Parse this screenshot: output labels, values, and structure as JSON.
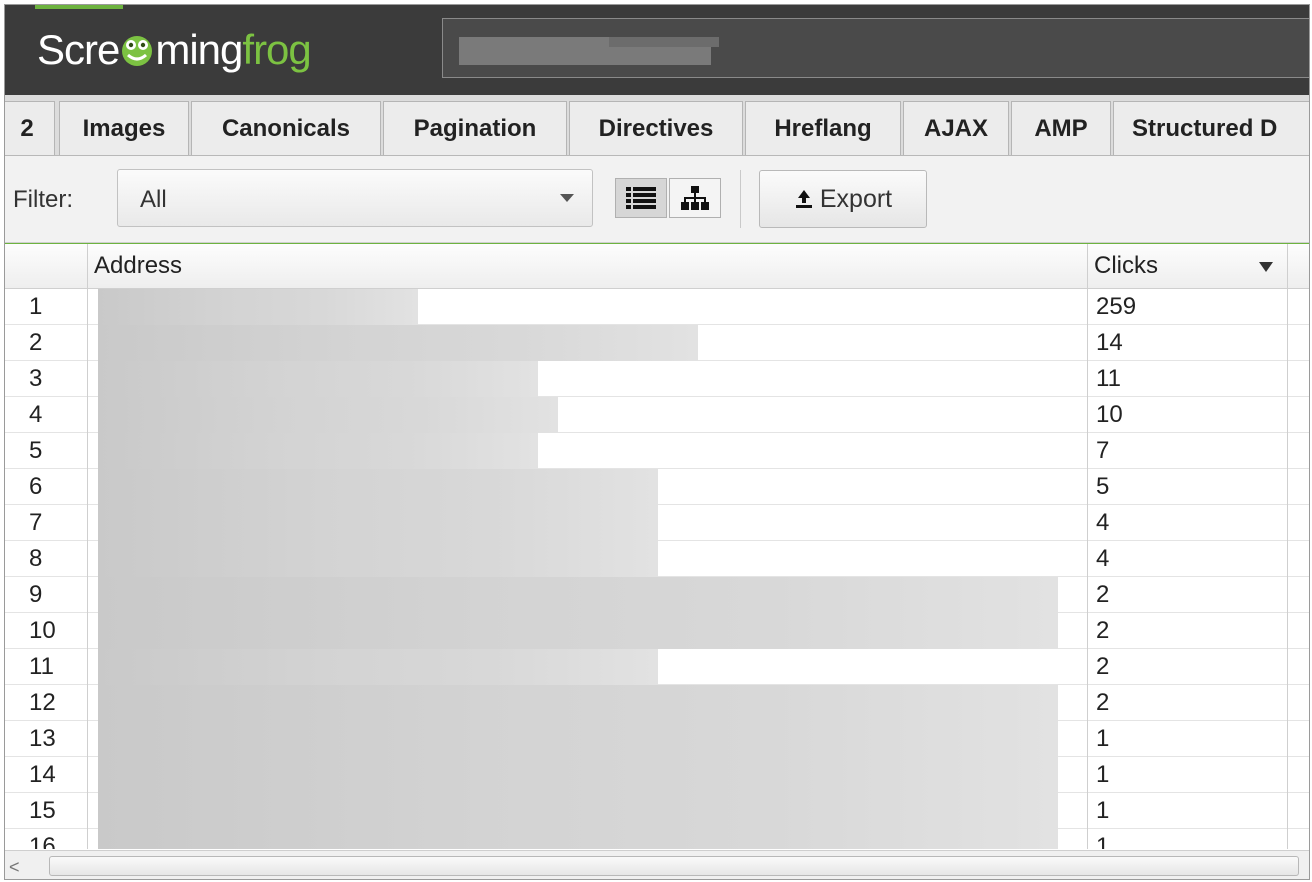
{
  "app": {
    "logo_part1": "Scre",
    "logo_part2": "ming",
    "logo_part3": "frog",
    "accent_color": "#7cc242"
  },
  "url_bar": {
    "value": ""
  },
  "tabs": [
    {
      "label": "2"
    },
    {
      "label": "Images"
    },
    {
      "label": "Canonicals"
    },
    {
      "label": "Pagination"
    },
    {
      "label": "Directives"
    },
    {
      "label": "Hreflang"
    },
    {
      "label": "AJAX"
    },
    {
      "label": "AMP"
    },
    {
      "label": "Structured D"
    }
  ],
  "toolbar": {
    "filter_label": "Filter:",
    "filter_value": "All",
    "list_view_icon": "list-icon",
    "tree_view_icon": "sitemap-icon",
    "export_label": "Export",
    "export_icon": "upload-icon"
  },
  "table": {
    "columns": [
      "",
      "Address",
      "Clicks"
    ],
    "rows": [
      {
        "num": "1",
        "address": "",
        "clicks": "259"
      },
      {
        "num": "2",
        "address": "",
        "clicks": "14"
      },
      {
        "num": "3",
        "address": "",
        "clicks": "11"
      },
      {
        "num": "4",
        "address": "",
        "clicks": "10"
      },
      {
        "num": "5",
        "address": "",
        "clicks": "7"
      },
      {
        "num": "6",
        "address": "",
        "clicks": "5"
      },
      {
        "num": "7",
        "address": "",
        "clicks": "4"
      },
      {
        "num": "8",
        "address": "",
        "clicks": "4"
      },
      {
        "num": "9",
        "address": "",
        "clicks": "2"
      },
      {
        "num": "10",
        "address": "",
        "clicks": "2"
      },
      {
        "num": "11",
        "address": "",
        "clicks": "2"
      },
      {
        "num": "12",
        "address": "",
        "clicks": "2"
      },
      {
        "num": "13",
        "address": "",
        "clicks": "1"
      },
      {
        "num": "14",
        "address": "",
        "clicks": "1"
      },
      {
        "num": "15",
        "address": "",
        "clicks": "1"
      },
      {
        "num": "16",
        "address": "",
        "clicks": "1"
      }
    ]
  },
  "scrollbar": {
    "left_arrow": "<"
  }
}
